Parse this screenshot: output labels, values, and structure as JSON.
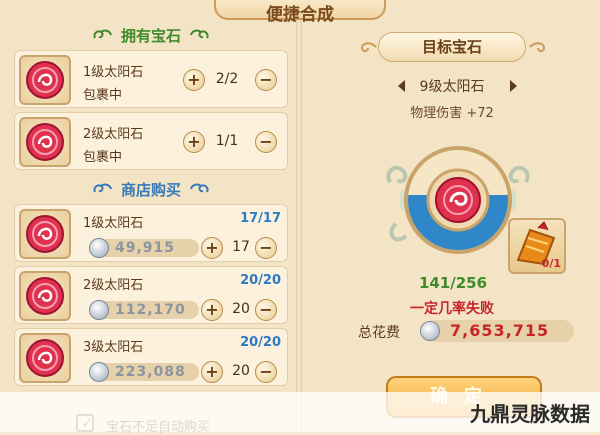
{
  "window": {
    "title": "便捷合成"
  },
  "owned": {
    "header": "拥有宝石",
    "items": [
      {
        "name": "1级太阳石",
        "location": "包裹中",
        "qty": "2/2"
      },
      {
        "name": "2级太阳石",
        "location": "包裹中",
        "qty": "1/1"
      }
    ]
  },
  "shop": {
    "header": "商店购买",
    "items": [
      {
        "name": "1级太阳石",
        "stock": "17/17",
        "price": "49,915",
        "qty": "17"
      },
      {
        "name": "2级太阳石",
        "stock": "20/20",
        "price": "112,170",
        "qty": "20"
      },
      {
        "name": "3级太阳石",
        "stock": "20/20",
        "price": "223,088",
        "qty": "20"
      }
    ]
  },
  "target": {
    "header": "目标宝石",
    "name": "9级太阳石",
    "attribute": "物理伤害 +72",
    "progress": "141/256",
    "progress_fraction": 0.55,
    "fail_note": "一定几率失败",
    "item_count": "0/1"
  },
  "cost": {
    "label": "总花费",
    "value": "7,653,715"
  },
  "confirm_label": "确定",
  "auto_buy_label": "宝石不足自动购买",
  "watermark": "九鼎灵脉数据",
  "colors": {
    "green": "#3f8a2a",
    "blue": "#2f7bc3",
    "red": "#c6262a",
    "gem": "#e0314f"
  }
}
